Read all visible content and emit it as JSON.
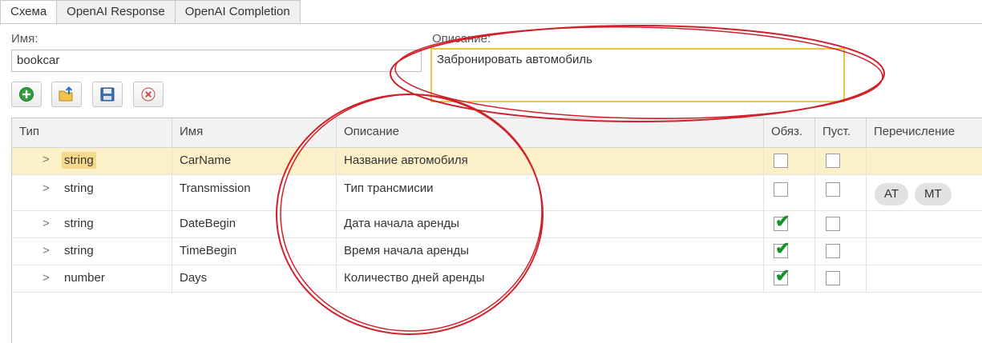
{
  "tabs": [
    {
      "label": "Схема",
      "active": true
    },
    {
      "label": "OpenAI Response",
      "active": false
    },
    {
      "label": "OpenAI Completion",
      "active": false
    }
  ],
  "form": {
    "name_label": "Имя:",
    "name_value": "bookcar",
    "desc_label": "Описание:",
    "desc_value": "Забронировать автомобиль"
  },
  "toolbar": [
    {
      "icon": "add-icon"
    },
    {
      "icon": "open-folder-icon"
    },
    {
      "icon": "save-icon"
    },
    {
      "icon": "delete-icon"
    }
  ],
  "grid": {
    "headers": {
      "type": "Тип",
      "name": "Имя",
      "description": "Описание",
      "required": "Обяз.",
      "empty": "Пуст.",
      "enum": "Перечисление"
    },
    "rows": [
      {
        "type": "string",
        "name": "CarName",
        "description": "Название автомобиля",
        "required": false,
        "empty": false,
        "enum": [],
        "selected": true
      },
      {
        "type": "string",
        "name": "Transmission",
        "description": "Тип трансмисии",
        "required": false,
        "empty": false,
        "enum": [
          "AT",
          "MT"
        ],
        "selected": false
      },
      {
        "type": "string",
        "name": "DateBegin",
        "description": "Дата начала аренды",
        "required": true,
        "empty": false,
        "enum": [],
        "selected": false
      },
      {
        "type": "string",
        "name": "TimeBegin",
        "description": "Время начала аренды",
        "required": true,
        "empty": false,
        "enum": [],
        "selected": false
      },
      {
        "type": "number",
        "name": "Days",
        "description": "Количество дней аренды",
        "required": true,
        "empty": false,
        "enum": [],
        "selected": false
      }
    ]
  },
  "colors": {
    "annotation": "#d0202a",
    "selected_row": "#fbf0c8",
    "check": "#1a8f2e",
    "focus_border": "#f2c341"
  }
}
